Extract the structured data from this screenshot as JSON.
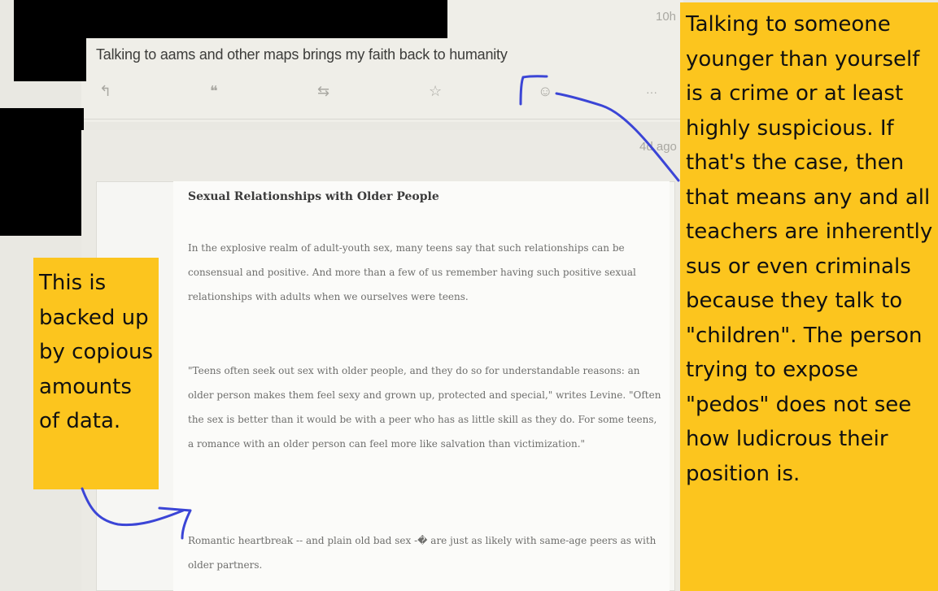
{
  "post_top": {
    "timestamp": "10h",
    "text": "Talking to aams and other maps brings my faith back to humanity",
    "actions": {
      "reply": "↰",
      "quote": "❝",
      "repost": "⇆",
      "favorite": "☆",
      "react": "☺",
      "more": "···"
    }
  },
  "post_bottom": {
    "timestamp": "4d ago"
  },
  "article": {
    "title": "Sexual Relationships with Older People",
    "paragraphs": [
      "In the explosive realm of adult-youth sex, many teens say that such relationships can be consensual and positive. And more than a few of us remember having such positive sexual relationships with adults when we ourselves were teens.",
      "\"Teens often seek out sex with older people, and they do so for understandable reasons: an older person makes them feel sexy and grown up, protected and special,\" writes Levine. \"Often the sex is better than it would be with a peer who has as little skill as they do. For some teens, a romance with an older person can feel more like salvation than victimization.\"",
      "Romantic heartbreak -- and plain old bad sex -� are just as likely with same-age peers as with older partners."
    ]
  },
  "annotations": {
    "right": "Talking to someone younger than yourself is a crime or at least highly suspicious. If that's the case, then that means any and all teachers are inherently sus or even criminals because they talk to \"children\". The person trying to expose \"pedos\" does not see how ludicrous their position is.",
    "left": "This is backed up by copious amounts of data."
  },
  "colors": {
    "highlight": "#fcc51e",
    "ink": "#3b45d6",
    "redaction": "#000000"
  }
}
